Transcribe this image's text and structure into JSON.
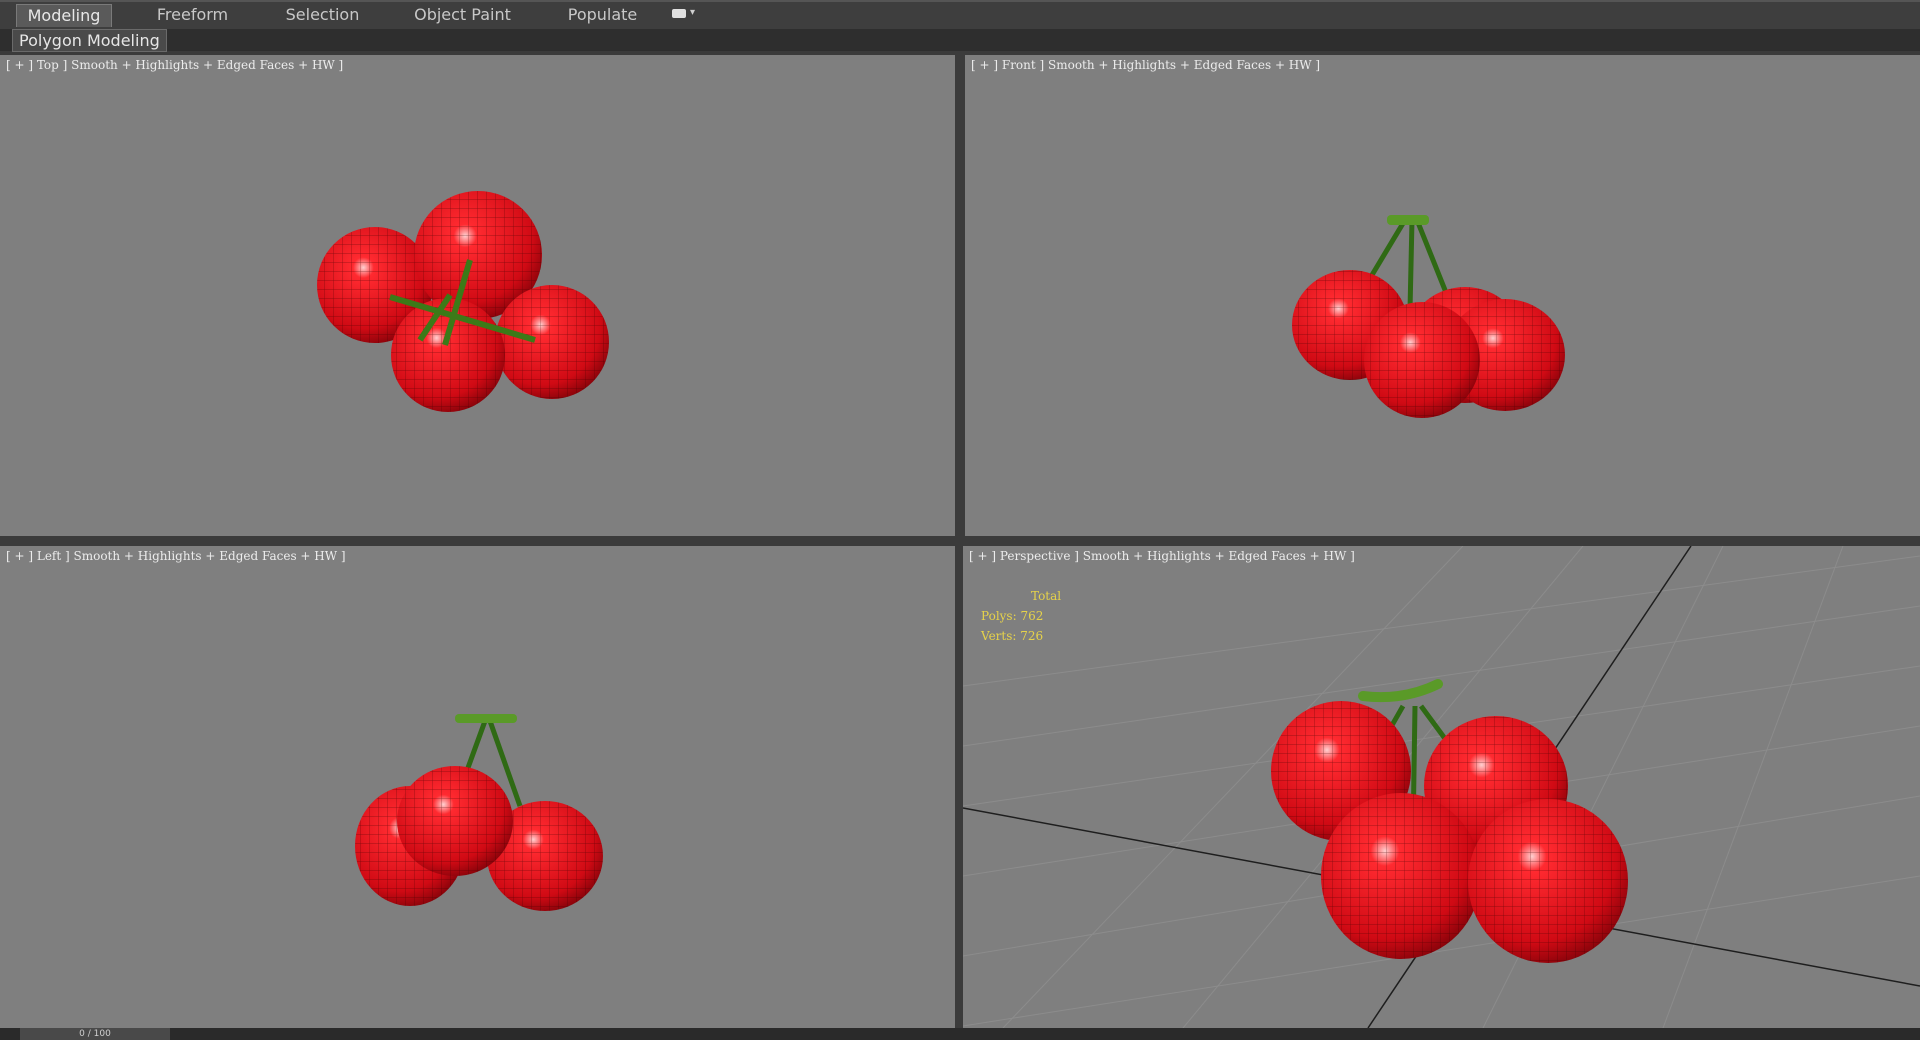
{
  "ribbon": {
    "tabs": [
      {
        "label": "Modeling",
        "active": true
      },
      {
        "label": "Freeform",
        "active": false
      },
      {
        "label": "Selection",
        "active": false
      },
      {
        "label": "Object Paint",
        "active": false
      },
      {
        "label": "Populate",
        "active": false
      }
    ],
    "panel_button": "Polygon Modeling"
  },
  "viewports": {
    "top": {
      "label": "[ + ] Top ] Smooth + Highlights + Edged Faces + HW ]"
    },
    "front": {
      "label": "[ + ] Front ] Smooth + Highlights + Edged Faces + HW ]"
    },
    "left": {
      "label": "[ + ] Left ] Smooth + Highlights + Edged Faces + HW ]"
    },
    "perspective": {
      "label": "[ + ] Perspective ] Smooth + Highlights + Edged Faces + HW ]",
      "stats": {
        "title": "Total",
        "polys": "Polys: 762",
        "verts": "Verts: 726"
      }
    }
  },
  "timeline": {
    "frame": "0 / 100"
  },
  "colors": {
    "viewport_bg": "#7f7f7f",
    "cherry_red": "#e0101a",
    "stem_green": "#4f8a1f",
    "stats_text": "#e6d24a"
  }
}
